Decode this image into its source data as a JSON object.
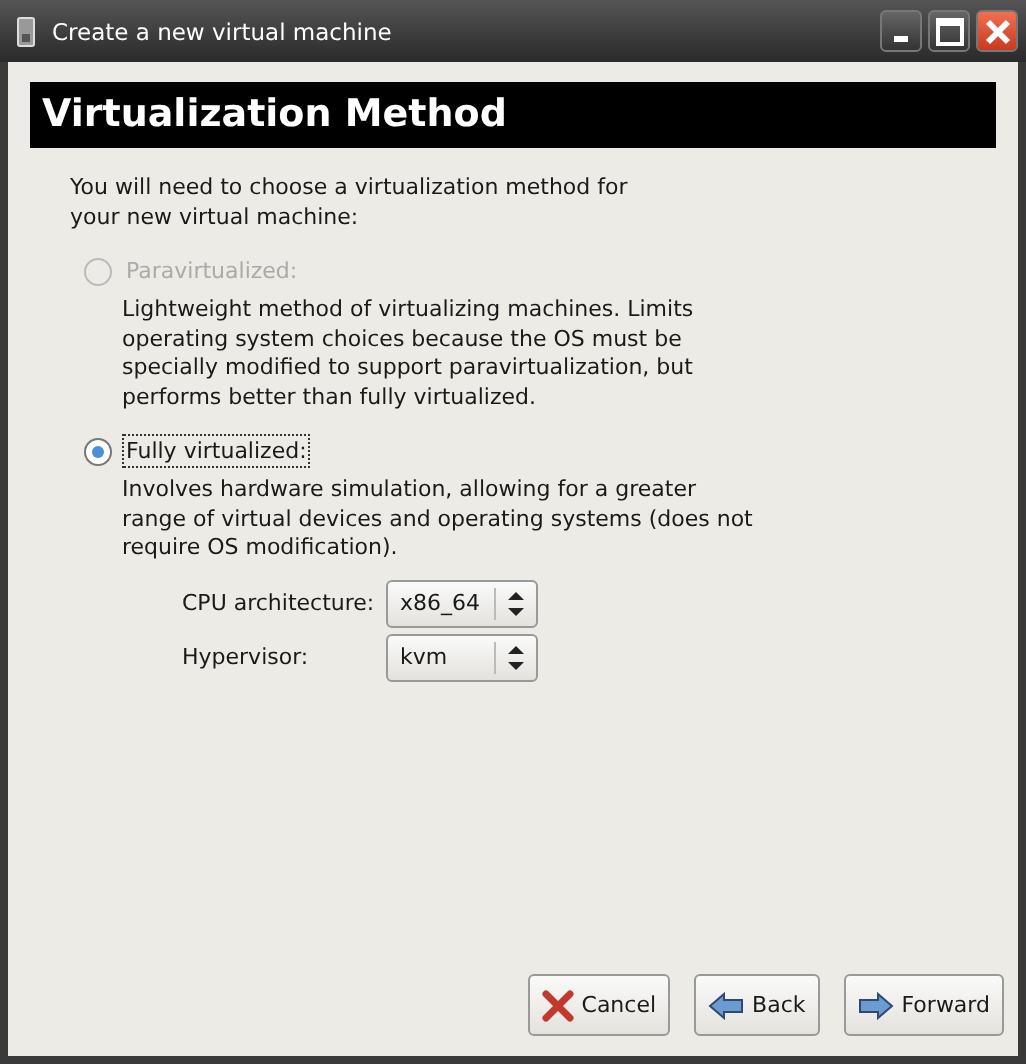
{
  "window": {
    "title": "Create a new virtual machine"
  },
  "header": "Virtualization Method",
  "intro": "You will need to choose a virtualization method for your new virtual machine:",
  "options": [
    {
      "label": "Paravirtualized:",
      "description": "Lightweight method of virtualizing machines. Limits operating system choices because the OS must be specially modified to support paravirtualization, but performs better than fully virtualized.",
      "selected": false,
      "disabled": true
    },
    {
      "label": "Fully virtualized:",
      "description": "Involves hardware simulation, allowing for a greater range of virtual devices and operating systems (does not require OS modification).",
      "selected": true,
      "disabled": false
    }
  ],
  "fields": [
    {
      "label": "CPU architecture:",
      "value": "x86_64"
    },
    {
      "label": "Hypervisor:",
      "value": "kvm"
    }
  ],
  "buttons": [
    {
      "label": "Cancel",
      "kind": "cancel"
    },
    {
      "label": "Back",
      "kind": "back"
    },
    {
      "label": "Forward",
      "kind": "forward"
    }
  ]
}
